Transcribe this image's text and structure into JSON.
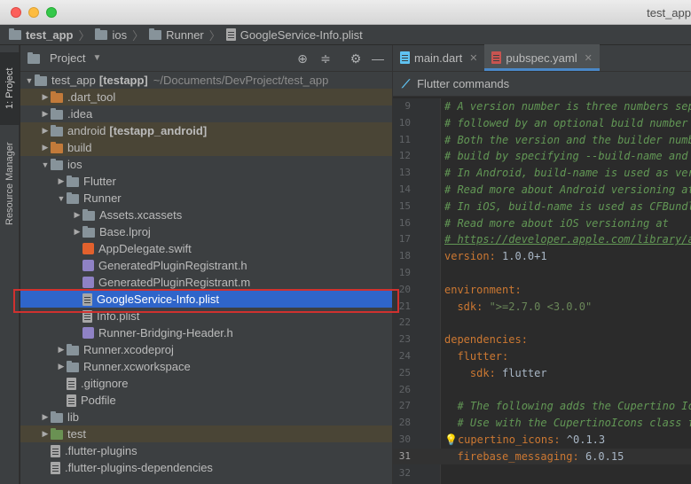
{
  "window": {
    "title": "test_app"
  },
  "breadcrumb": [
    {
      "label": "test_app",
      "icon": "folder-icon"
    },
    {
      "label": "ios",
      "icon": "folder-icon"
    },
    {
      "label": "Runner",
      "icon": "folder-icon"
    },
    {
      "label": "GoogleService-Info.plist",
      "icon": "file-icon"
    }
  ],
  "side_strip": {
    "project_tab": "1: Project",
    "resource_tab": "Resource Manager"
  },
  "project_panel": {
    "title": "Project",
    "tree": [
      {
        "label": "test_app",
        "bold": "[testapp]",
        "path": "~/Documents/DevProject/test_app",
        "icon": "folder-icon",
        "arrow": "▼"
      },
      {
        "label": ".dart_tool",
        "icon": "folder-icon",
        "arrow": "▶"
      },
      {
        "label": ".idea",
        "icon": "folder-icon",
        "arrow": "▶"
      },
      {
        "label": "android",
        "bold": "[testapp_android]",
        "icon": "folder-icon",
        "arrow": "▶"
      },
      {
        "label": "build",
        "icon": "folder-icon",
        "arrow": "▶"
      },
      {
        "label": "ios",
        "icon": "folder-icon",
        "arrow": "▼"
      },
      {
        "label": "Flutter",
        "icon": "folder-icon",
        "arrow": "▶"
      },
      {
        "label": "Runner",
        "icon": "folder-icon",
        "arrow": "▼"
      },
      {
        "label": "Assets.xcassets",
        "icon": "folder-icon",
        "arrow": "▶"
      },
      {
        "label": "Base.lproj",
        "icon": "folder-icon",
        "arrow": "▶"
      },
      {
        "label": "AppDelegate.swift",
        "icon": "swift-file-icon",
        "arrow": ""
      },
      {
        "label": "GeneratedPluginRegistrant.h",
        "icon": "header-file-icon",
        "arrow": ""
      },
      {
        "label": "GeneratedPluginRegistrant.m",
        "icon": "header-file-icon",
        "arrow": ""
      },
      {
        "label": "GoogleService-Info.plist",
        "icon": "file-icon",
        "arrow": ""
      },
      {
        "label": "Info.plist",
        "icon": "file-icon",
        "arrow": ""
      },
      {
        "label": "Runner-Bridging-Header.h",
        "icon": "header-file-icon",
        "arrow": ""
      },
      {
        "label": "Runner.xcodeproj",
        "icon": "folder-icon",
        "arrow": "▶"
      },
      {
        "label": "Runner.xcworkspace",
        "icon": "folder-icon",
        "arrow": "▶"
      },
      {
        "label": ".gitignore",
        "icon": "file-icon",
        "arrow": ""
      },
      {
        "label": "Podfile",
        "icon": "file-icon",
        "arrow": ""
      },
      {
        "label": "lib",
        "icon": "folder-icon",
        "arrow": "▶"
      },
      {
        "label": "test",
        "icon": "folder-icon",
        "arrow": "▶"
      },
      {
        "label": ".flutter-plugins",
        "icon": "file-icon",
        "arrow": ""
      },
      {
        "label": ".flutter-plugins-dependencies",
        "icon": "file-icon",
        "arrow": ""
      }
    ]
  },
  "editor": {
    "tabs": [
      {
        "label": "main.dart",
        "active": false
      },
      {
        "label": "pubspec.yaml",
        "active": true
      }
    ],
    "flutter_bar": "Flutter commands",
    "lines": [
      {
        "n": "9",
        "text": "# A version number is three numbers sepa"
      },
      {
        "n": "10",
        "text": "# followed by an optional build number s"
      },
      {
        "n": "11",
        "text": "# Both the version and the builder numbe"
      },
      {
        "n": "12",
        "text": "# build by specifying --build-name and -"
      },
      {
        "n": "13",
        "text": "# In Android, build-name is used as vers"
      },
      {
        "n": "14",
        "text": "# Read more about Android versioning at "
      },
      {
        "n": "15",
        "text": "# In iOS, build-name is used as CFBundle"
      },
      {
        "n": "16",
        "text": "# Read more about iOS versioning at"
      },
      {
        "n": "17",
        "text": "# https://developer.apple.com/library/ar"
      },
      {
        "n": "18",
        "key": "version",
        "value": " 1.0.0+1"
      },
      {
        "n": "19",
        "text": ""
      },
      {
        "n": "20",
        "key": "environment",
        "value": ""
      },
      {
        "n": "21",
        "key": "  sdk",
        "value": " \">=2.7.0 <3.0.0\""
      },
      {
        "n": "22",
        "text": ""
      },
      {
        "n": "23",
        "key": "dependencies",
        "value": ""
      },
      {
        "n": "24",
        "key": "  flutter",
        "value": ""
      },
      {
        "n": "25",
        "key": "    sdk",
        "value": " flutter"
      },
      {
        "n": "26",
        "text": ""
      },
      {
        "n": "27",
        "text": "  # The following adds the Cupertino Ico"
      },
      {
        "n": "28",
        "text": "  # Use with the CupertinoIcons class fo"
      },
      {
        "n": "30",
        "key": "cupertino_icons",
        "value": " ^0.1.3"
      },
      {
        "n": "31",
        "key": "  firebase_messaging",
        "value": " 6.0.15"
      },
      {
        "n": "32",
        "text": ""
      }
    ]
  }
}
